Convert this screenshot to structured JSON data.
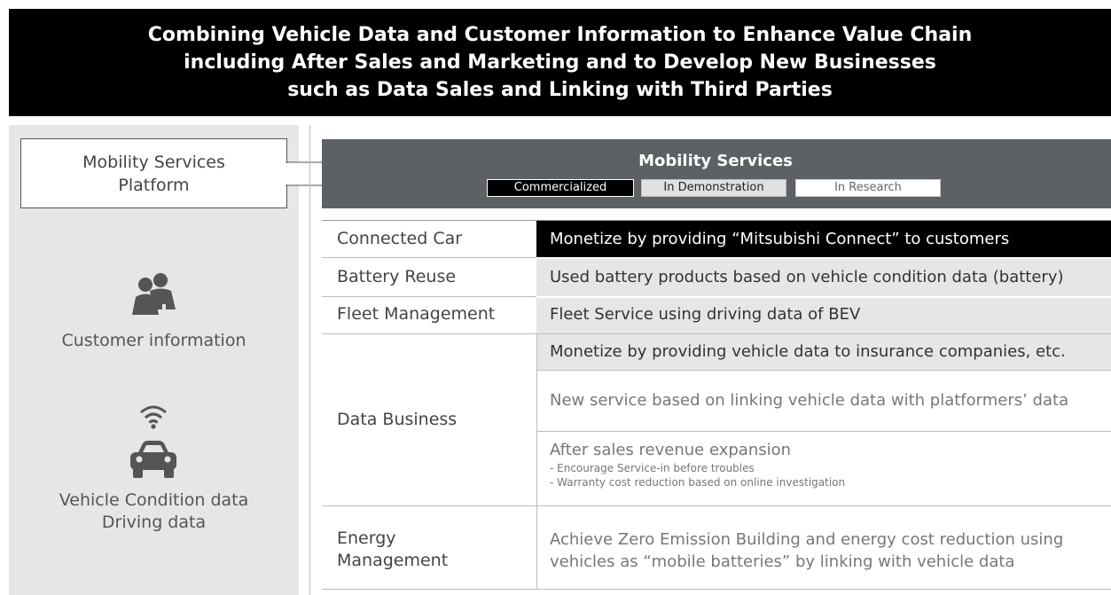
{
  "banner": {
    "line1": "Combining Vehicle Data and Customer Information to Enhance Value Chain",
    "line2": "including After Sales and Marketing and to Develop New Businesses",
    "line3": "such as Data Sales and Linking with Third Parties"
  },
  "platform": {
    "line1": "Mobility Services",
    "line2": "Platform"
  },
  "left": {
    "customer_info": "Customer information",
    "vehicle_line1": "Vehicle Condition data",
    "vehicle_line2": "Driving data"
  },
  "mobility_services": {
    "title": "Mobility Services",
    "legend": {
      "commercialized": "Commercialized",
      "demonstration": "In Demonstration",
      "research": "In Research"
    }
  },
  "colors": {
    "commercialized": "#000000",
    "demonstration": "#e4e6e8",
    "research": "#ffffff",
    "header": "#5d6064"
  },
  "rows": {
    "connected_car": {
      "label": "Connected Car",
      "text": "Monetize by providing “Mitsubishi Connect” to customers"
    },
    "battery_reuse": {
      "label": "Battery Reuse",
      "text": "Used battery products based on vehicle condition data (battery)"
    },
    "fleet": {
      "label": "Fleet Management",
      "text": "Fleet Service using driving data of BEV"
    },
    "data_business": {
      "label": "Data Business",
      "item1": "Monetize by providing vehicle data to insurance companies, etc.",
      "item2": "New service based on linking vehicle data with platformers’ data",
      "item3_title": "After sales revenue expansion",
      "item3_sub1": "- Encourage Service-in before troubles",
      "item3_sub2": "- Warranty  cost reduction based on online investigation"
    },
    "energy": {
      "label_line1": "Energy",
      "label_line2": "Management",
      "line1": "Achieve Zero Emission Building and energy cost reduction using",
      "line2": "vehicles as “mobile batteries” by linking with vehicle data"
    }
  }
}
